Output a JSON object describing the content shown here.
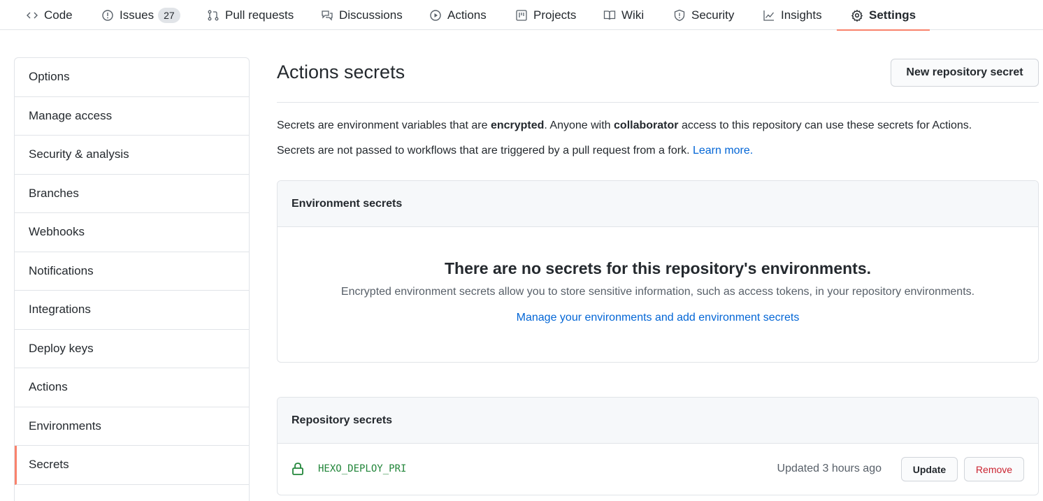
{
  "repo_nav": {
    "tabs": [
      {
        "label": "Code",
        "icon": "code-icon"
      },
      {
        "label": "Issues",
        "icon": "issue-icon",
        "count": "27"
      },
      {
        "label": "Pull requests",
        "icon": "pull-request-icon"
      },
      {
        "label": "Discussions",
        "icon": "discussions-icon"
      },
      {
        "label": "Actions",
        "icon": "play-icon"
      },
      {
        "label": "Projects",
        "icon": "project-icon"
      },
      {
        "label": "Wiki",
        "icon": "book-icon"
      },
      {
        "label": "Security",
        "icon": "shield-icon"
      },
      {
        "label": "Insights",
        "icon": "graph-icon"
      },
      {
        "label": "Settings",
        "icon": "gear-icon",
        "active": true
      }
    ],
    "active_underline_color": "#f9826c"
  },
  "sidebar": {
    "items": [
      {
        "label": "Options"
      },
      {
        "label": "Manage access"
      },
      {
        "label": "Security & analysis"
      },
      {
        "label": "Branches"
      },
      {
        "label": "Webhooks"
      },
      {
        "label": "Notifications"
      },
      {
        "label": "Integrations"
      },
      {
        "label": "Deploy keys"
      },
      {
        "label": "Actions"
      },
      {
        "label": "Environments"
      },
      {
        "label": "Secrets",
        "selected": true
      }
    ]
  },
  "main": {
    "title": "Actions secrets",
    "new_secret_button": "New repository secret",
    "description": {
      "line1_a": "Secrets are environment variables that are ",
      "line1_b": "encrypted",
      "line1_c": ". Anyone with ",
      "line1_d": "collaborator",
      "line1_e": " access to this repository can use these secrets for Actions.",
      "line2": "Secrets are not passed to workflows that are triggered by a pull request from a fork. ",
      "learn_more": "Learn more."
    },
    "environment_secrets": {
      "header": "Environment secrets",
      "blank_title": "There are no secrets for this repository's environments.",
      "blank_text": "Encrypted environment secrets allow you to store sensitive information, such as access tokens, in your repository environments.",
      "blank_link": "Manage your environments and add environment secrets"
    },
    "repository_secrets": {
      "header": "Repository secrets",
      "rows": [
        {
          "name": "HEXO_DEPLOY_PRI",
          "icon": "lock-icon",
          "updated": "Updated 3 hours ago",
          "update_label": "Update",
          "remove_label": "Remove"
        }
      ]
    }
  },
  "colors": {
    "link": "#0366d6",
    "secret_name": "#22863a",
    "remove": "#cb2431",
    "accent": "#f9826c"
  }
}
